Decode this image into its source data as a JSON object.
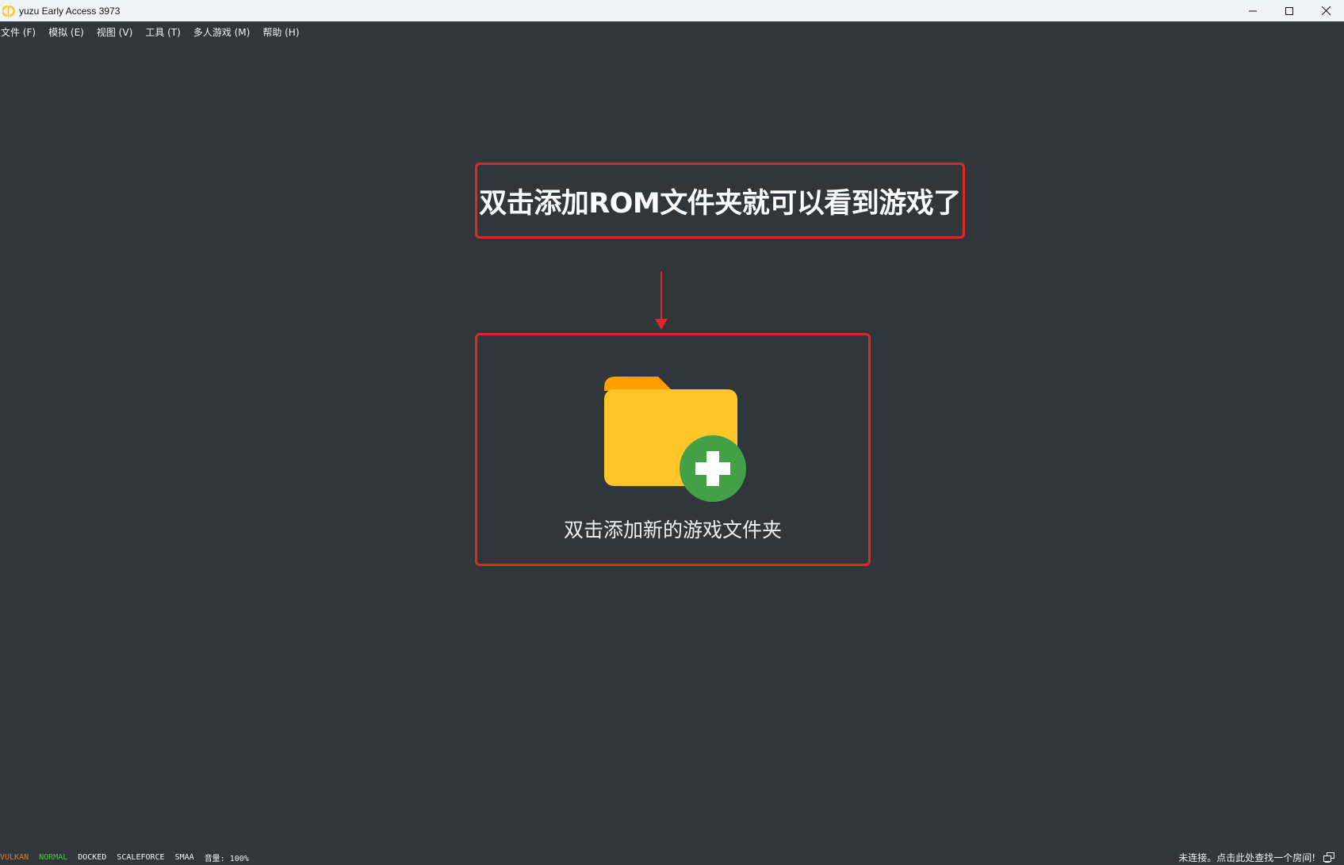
{
  "window": {
    "title": "yuzu Early Access 3973"
  },
  "menu": {
    "items": [
      {
        "label": "文件 (F)"
      },
      {
        "label": "模拟 (E)"
      },
      {
        "label": "视图 (V)"
      },
      {
        "label": "工具 (T)"
      },
      {
        "label": "多人游戏 (M)"
      },
      {
        "label": "帮助 (H)"
      }
    ]
  },
  "annotation": {
    "callout_text": "双击添加ROM文件夹就可以看到游戏了"
  },
  "game_list": {
    "add_folder_label": "双击添加新的游戏文件夹"
  },
  "status": {
    "api": "VULKAN",
    "gpu_accuracy": "NORMAL",
    "dock_mode": "DOCKED",
    "filter": "SCALEFORCE",
    "aa": "SMAA",
    "volume": "音量: 100%",
    "multiplayer": "未连接。点击此处查找一个房间!"
  },
  "colors": {
    "background": "#31363b",
    "annotation_red": "#e0262a",
    "api_vulkan": "#e07b25",
    "accuracy_normal": "#4fc14a",
    "folder_yellow": "#ffc629",
    "folder_tab": "#ffa000",
    "plus_green": "#43a047"
  }
}
